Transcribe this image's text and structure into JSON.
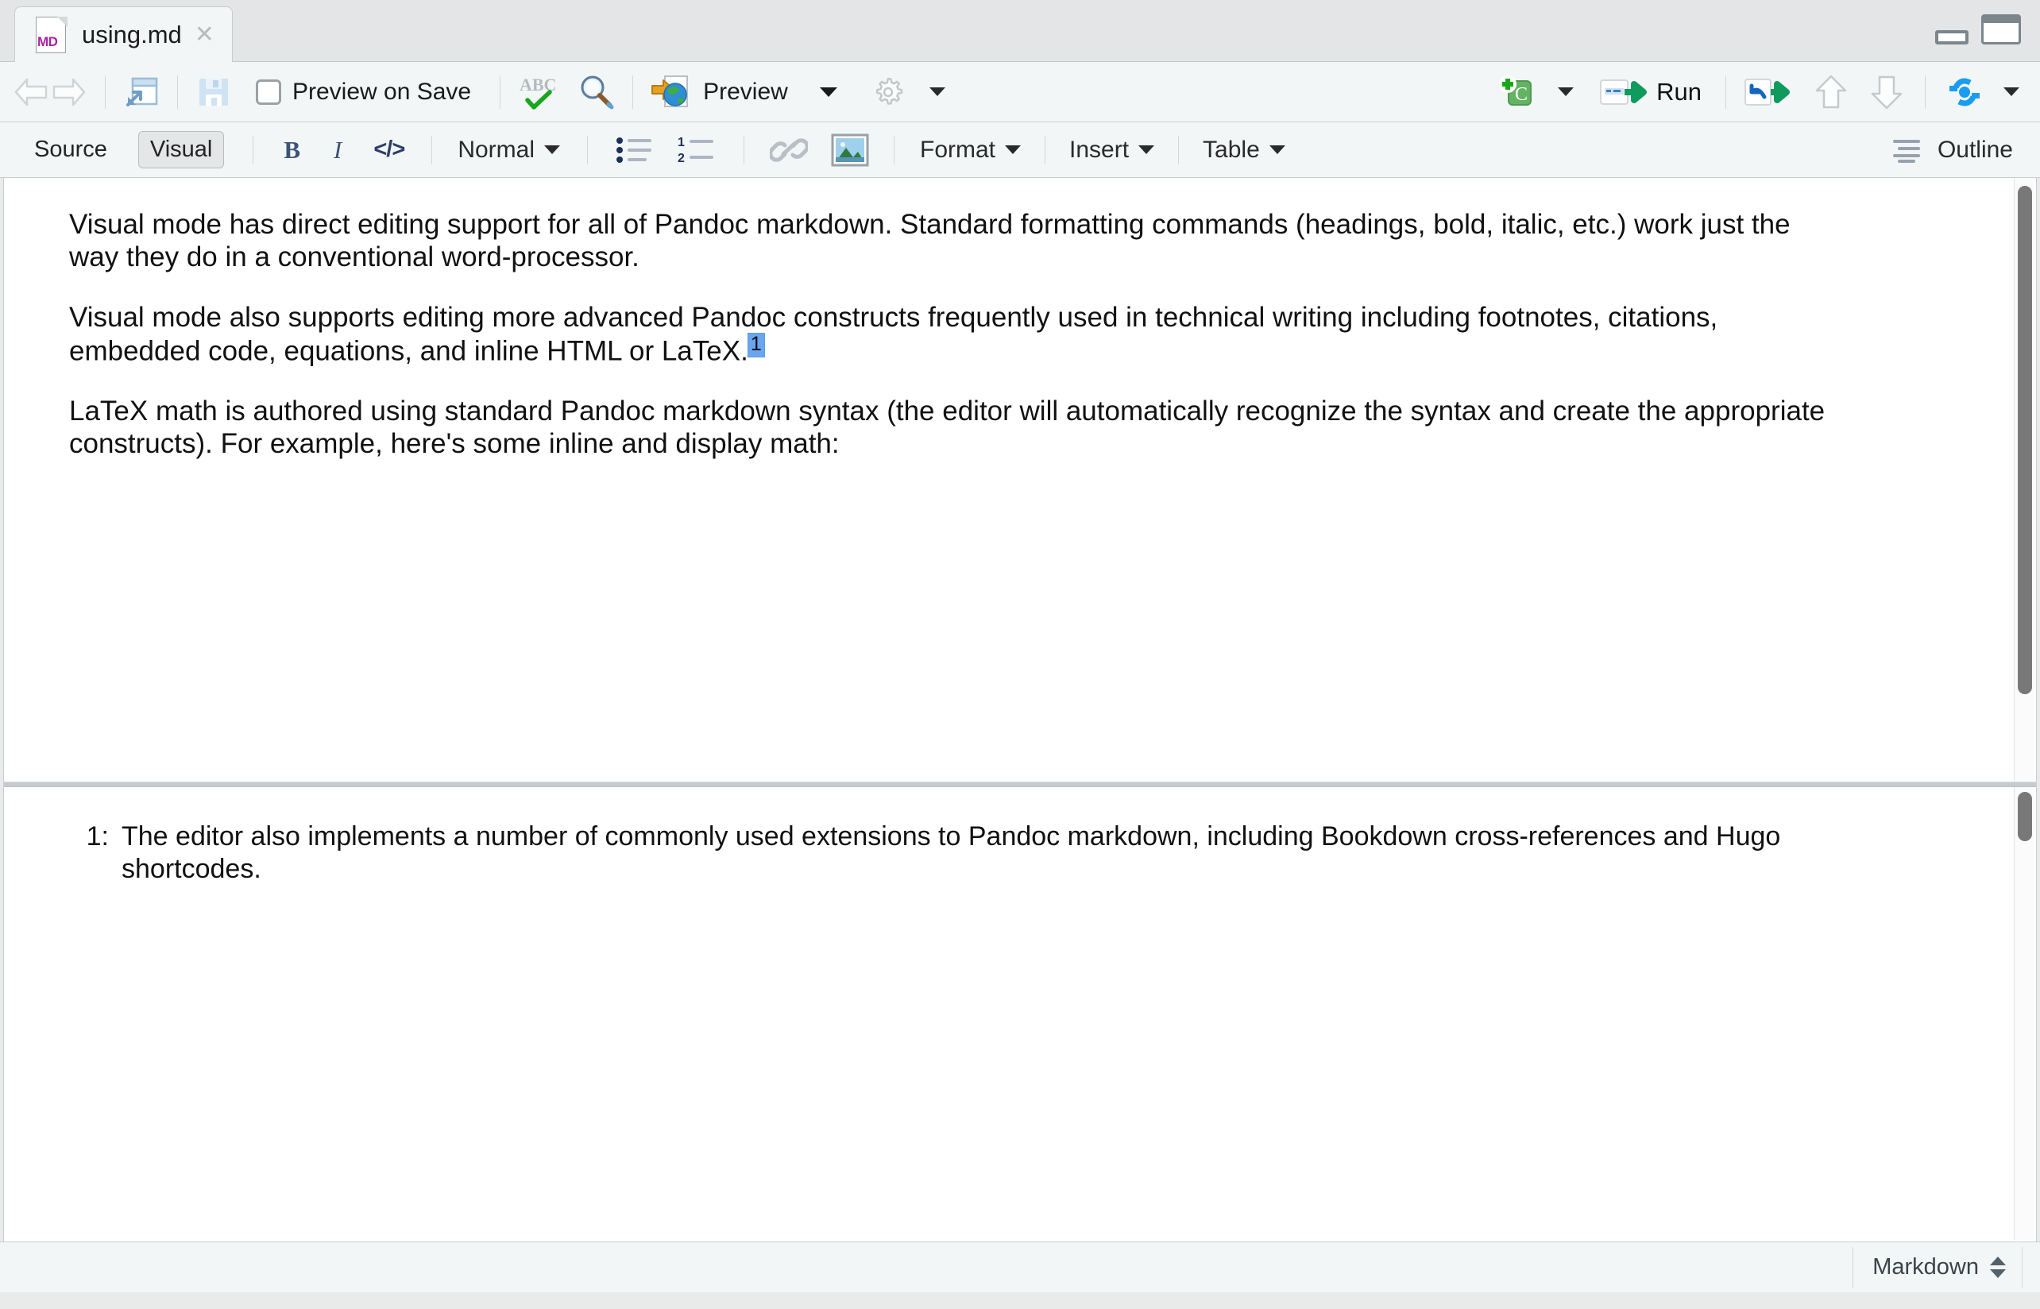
{
  "window": {
    "minimize_icon": "minimize-panel-icon",
    "maximize_icon": "maximize-panel-icon"
  },
  "tab": {
    "filename": "using.md",
    "file_type_badge": "MD",
    "close_glyph": "✕"
  },
  "toolbar_top": {
    "back_icon": "back-arrow-icon",
    "forward_icon": "forward-arrow-icon",
    "popout_icon": "show-in-new-window-icon",
    "save_icon": "save-icon",
    "preview_on_save_label": "Preview on Save",
    "spellcheck_icon": "spellcheck-abc-icon",
    "find_icon": "find-replace-magnifier-icon",
    "preview_icon": "preview-html-globe-icon",
    "preview_label": "Preview",
    "preview_caret": "chevron-down-icon",
    "settings_icon": "gear-icon",
    "settings_caret": "chevron-down-icon",
    "insert_chunk_icon": "insert-chunk-icon",
    "insert_chunk_caret": "chevron-down-icon",
    "run_icon": "run-icon",
    "run_label": "Run",
    "rerun_icon": "rerun-previous-icon",
    "chunk_up_icon": "run-previous-chunks-icon",
    "chunk_down_icon": "run-next-chunk-icon",
    "publish_icon": "publish-icon",
    "publish_caret": "chevron-down-icon"
  },
  "toolbar_format": {
    "source_label": "Source",
    "visual_label": "Visual",
    "active_mode": "Visual",
    "bold_label": "B",
    "italic_label": "I",
    "code_label": "</>",
    "block_format_label": "Normal",
    "block_format_caret": "chevron-down-icon",
    "bullet_list_icon": "bullet-list-icon",
    "numbered_list_icon": "numbered-list-icon",
    "link_icon": "link-icon",
    "image_icon": "image-icon",
    "format_label": "Format",
    "format_caret": "chevron-down-icon",
    "insert_label": "Insert",
    "insert_caret": "chevron-down-icon",
    "table_label": "Table",
    "table_caret": "chevron-down-icon",
    "outline_icon": "outline-icon",
    "outline_label": "Outline"
  },
  "document": {
    "paragraphs": [
      "Visual mode has direct editing support for all of Pandoc markdown. Standard formatting commands (headings, bold, italic, etc.) work just the way they do in a conventional word-processor.",
      "Visual mode also supports editing more advanced Pandoc constructs frequently used in technical writing including footnotes, citations, embedded code, equations, and inline HTML or LaTeX.",
      "LaTeX math is authored using standard Pandoc markdown syntax (the editor will automatically recognize the syntax and create the appropriate constructs). For example, here's some inline and display math:"
    ],
    "footnote_marker": "1",
    "footnote_marker_highlight": "#6aa6f0"
  },
  "footnote_pane": {
    "number": "1:",
    "text": "The editor also implements a number of commonly used extensions to Pandoc markdown, including Bookdown cross-references and Hugo shortcodes."
  },
  "statusbar": {
    "format_label": "Markdown",
    "format_spinner_icon": "updown-spinner-icon"
  }
}
